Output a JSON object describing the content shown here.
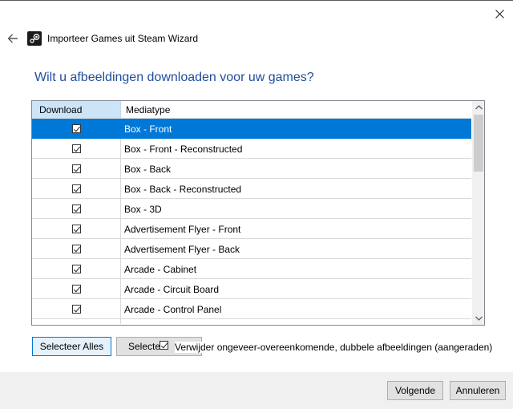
{
  "window": {
    "title": "Importeer Games uit Steam Wizard",
    "icons": {
      "close": "close-icon",
      "back": "back-arrow-icon",
      "app": "steam-icon"
    }
  },
  "heading": "Wilt u afbeeldingen downloaden voor uw games?",
  "grid": {
    "columns": [
      "Download",
      "Mediatype"
    ],
    "rows": [
      {
        "download": true,
        "media_type": "Box - Front",
        "selected": true
      },
      {
        "download": true,
        "media_type": "Box - Front - Reconstructed"
      },
      {
        "download": true,
        "media_type": "Box - Back"
      },
      {
        "download": true,
        "media_type": "Box - Back - Reconstructed"
      },
      {
        "download": true,
        "media_type": "Box - 3D"
      },
      {
        "download": true,
        "media_type": "Advertisement Flyer - Front"
      },
      {
        "download": true,
        "media_type": "Advertisement Flyer - Back"
      },
      {
        "download": true,
        "media_type": "Arcade - Cabinet"
      },
      {
        "download": true,
        "media_type": "Arcade - Circuit Board"
      },
      {
        "download": true,
        "media_type": "Arcade - Control Panel"
      }
    ]
  },
  "buttons": {
    "select_all": "Selecteer Alles",
    "select_none": "Selecte",
    "next": "Volgende",
    "cancel": "Annuleren"
  },
  "remove_duplicates": {
    "label": "Verwijder ongeveer-overeenkomende, dubbele afbeeldingen (aangeraden)",
    "checked": true
  },
  "colors": {
    "selection": "#0078d7",
    "heading": "#1f4e9c",
    "header_highlight": "#cce4f7"
  }
}
